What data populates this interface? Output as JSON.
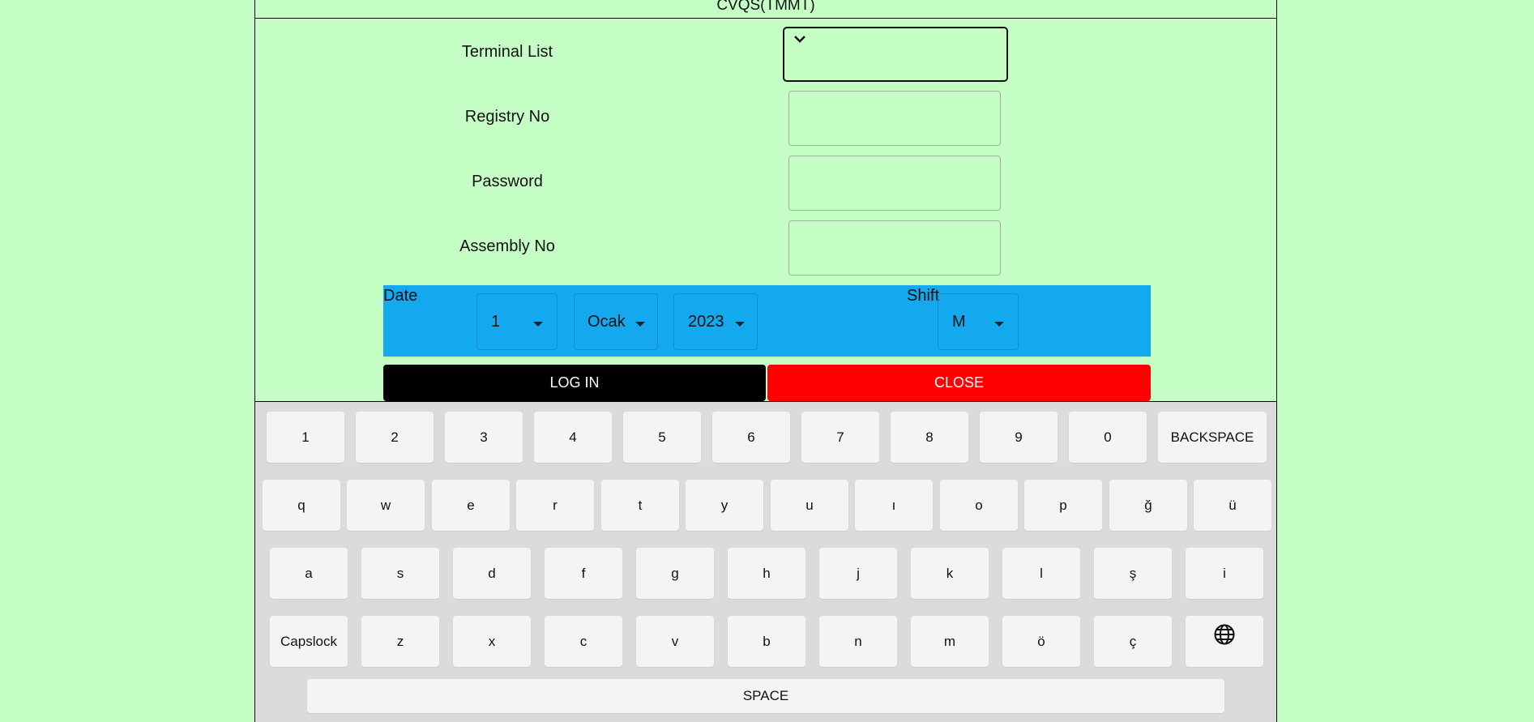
{
  "title": "CVQS(TMMT)",
  "form": {
    "terminal_label": "Terminal List",
    "registry_label": "Registry No",
    "password_label": "Password",
    "assembly_label": "Assembly No",
    "terminal_value": "",
    "registry_value": "",
    "password_value": "",
    "assembly_value": ""
  },
  "date_panel": {
    "date_label": "Date",
    "day": "1",
    "month": "Ocak",
    "year": "2023",
    "shift_label": "Shift",
    "shift": "M"
  },
  "buttons": {
    "login": "LOG IN",
    "close": "CLOSE"
  },
  "colors": {
    "background": "#c6ffc6",
    "panel": "#14a8ee",
    "login": "#000000",
    "close": "#ff0000"
  },
  "keyboard": {
    "row1": [
      "1",
      "2",
      "3",
      "4",
      "5",
      "6",
      "7",
      "8",
      "9",
      "0",
      "BACKSPACE"
    ],
    "row2": [
      "q",
      "w",
      "e",
      "r",
      "t",
      "y",
      "u",
      "ı",
      "o",
      "p",
      "ğ",
      "ü"
    ],
    "row3": [
      "a",
      "s",
      "d",
      "f",
      "g",
      "h",
      "j",
      "k",
      "l",
      "ş",
      "i"
    ],
    "row4": [
      "Capslock",
      "z",
      "x",
      "c",
      "v",
      "b",
      "n",
      "m",
      "ö",
      "ç"
    ],
    "globe_icon": "globe-icon",
    "space": "SPACE"
  }
}
